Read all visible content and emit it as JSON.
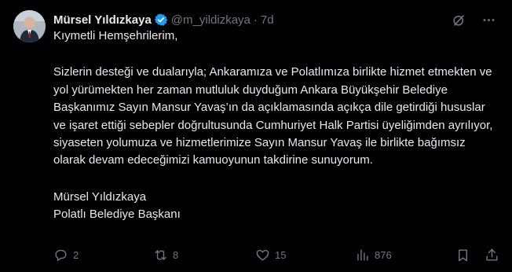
{
  "author": {
    "name": "Mürsel Yıldızkaya",
    "handle": "@m_yildizkaya",
    "separator": "·",
    "time": "7d"
  },
  "tweet": {
    "greeting": "Kıymetli Hemşehrilerim,",
    "paragraph": "Sizlerin desteği ve dualarıyla; Ankaramıza ve Polatlımıza birlikte hizmet etmekten ve yol yürümekten her zaman mutluluk duyduğum Ankara Büyükşehir Belediye Başkanımız Sayın Mansur Yavaş’ın da açıklamasında açıkça dile getirdiği hususlar ve işaret ettiği sebepler doğrultusunda Cumhuriyet Halk Partisi üyeliğimden ayrılıyor, siyaseten yolumuza ve hizmetlerimize Sayın Mansur Yavaş ile birlikte bağımsız olarak devam edeceğimizi kamuoyunun takdirine sunuyorum.",
    "signature_name": "Mürsel Yıldızkaya",
    "signature_title": "Polatlı Belediye Başkanı"
  },
  "actions": {
    "replies": "2",
    "retweets": "8",
    "likes": "15",
    "views": "876"
  },
  "colors": {
    "background": "#000000",
    "text": "#e7e9ea",
    "muted": "#71767b",
    "verified": "#1d9bf0"
  },
  "icons": [
    "verified-badge-icon",
    "grok-icon",
    "more-icon",
    "reply-icon",
    "retweet-icon",
    "like-icon",
    "views-icon",
    "bookmark-icon",
    "share-icon"
  ]
}
